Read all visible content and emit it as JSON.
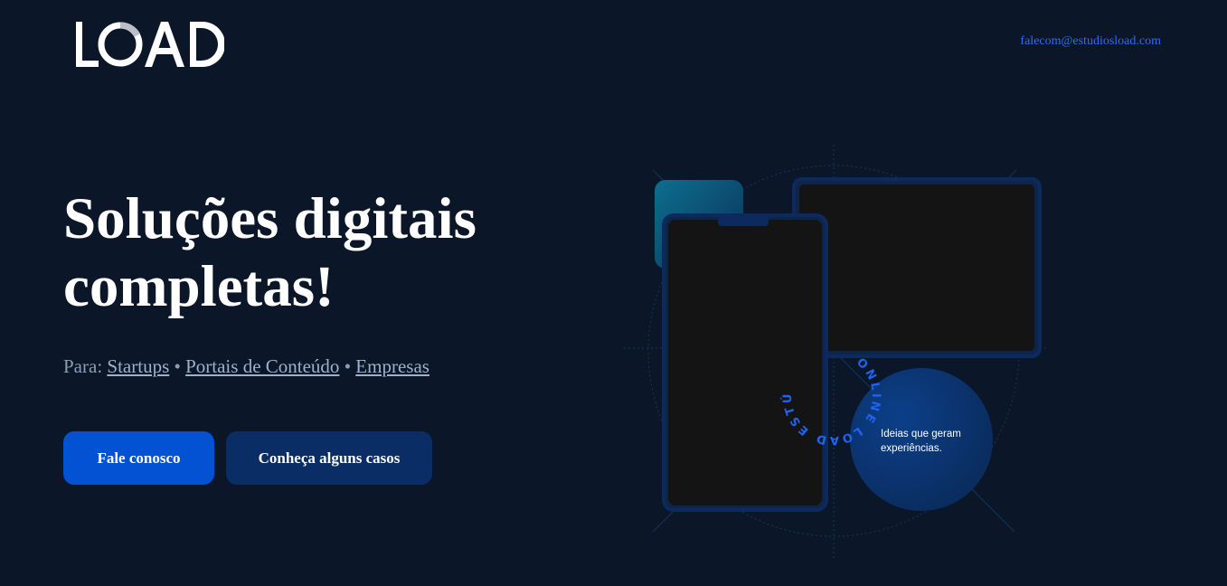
{
  "header": {
    "logo_text": "LOAD",
    "email": "falecom@estudiosload.com"
  },
  "hero": {
    "title_line1": "Soluções digitais",
    "title_line2": "completas!",
    "audience_prefix": "Para:",
    "audience_separator": "•",
    "audience_links": [
      "Startups",
      "Portais de Conteúdo",
      "Empresas"
    ]
  },
  "buttons": {
    "primary": "Fale conosco",
    "secondary": "Conheça alguns casos"
  },
  "illustration": {
    "circle_text": "ONLINE  LOAD ESTÚDIO",
    "bubble_line1": "Ideias que geram",
    "bubble_line2": "experiências."
  },
  "colors": {
    "background": "#0b1628",
    "accent": "#0352d3",
    "secondary_button": "#0a2d66",
    "link": "#2f6df6"
  }
}
